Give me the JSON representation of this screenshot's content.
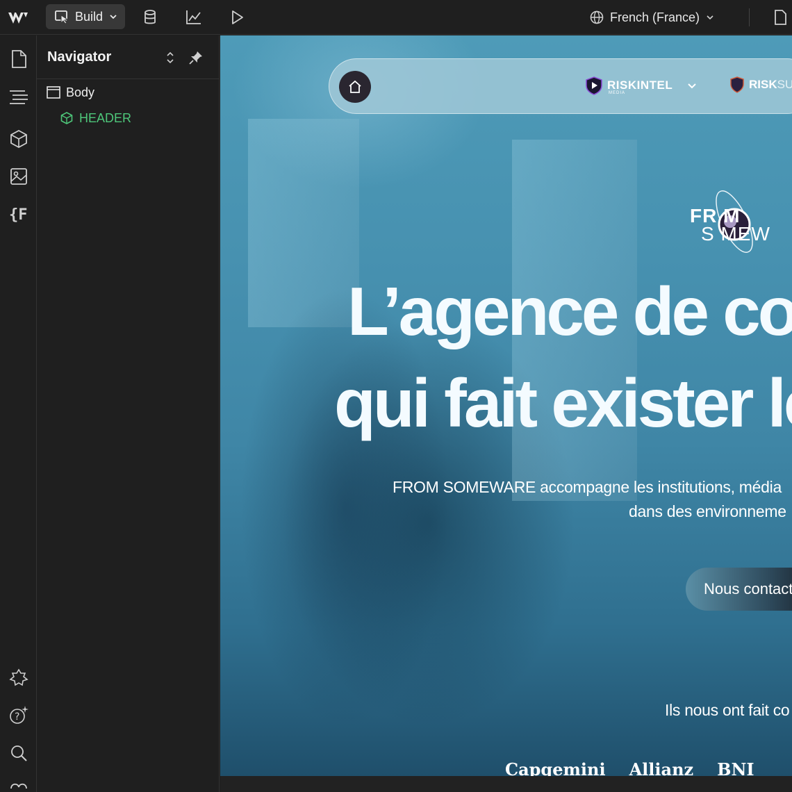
{
  "topbar": {
    "mode_label": "Build",
    "locale_label": "French (France)"
  },
  "navigator": {
    "title": "Navigator",
    "tree": [
      {
        "label": "Body"
      },
      {
        "label": "HEADER"
      }
    ]
  },
  "canvas": {
    "nav": {
      "brand1": "RISKINTEL",
      "brand1_sub": "MEDIA",
      "brand2_a": "RISK",
      "brand2_b": "SUM"
    },
    "logo": {
      "line1": "FR  M",
      "line2": "S   MEW"
    },
    "hero": {
      "line1": "L’agence de co",
      "line2": "qui fait exister le",
      "sub1": "FROM SOMEWARE accompagne les institutions, média",
      "sub2": "dans des environneme"
    },
    "cta_label": "Nous contact",
    "refs_label": "Ils nous ont fait co",
    "clients": [
      "Capgemini",
      "Allianz",
      "BNI"
    ]
  },
  "colors": {
    "accent_green": "#4ec77a",
    "canvas_blue": "#4791b0",
    "panel_bg": "#1f1f1f"
  }
}
